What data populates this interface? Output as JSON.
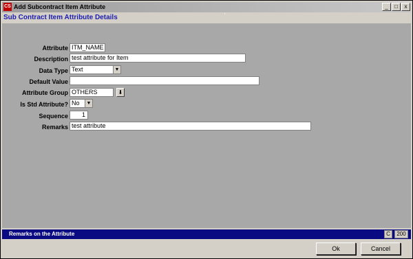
{
  "window": {
    "title": "Add Subcontract Item Attribute",
    "app_icon": "CS"
  },
  "title_buttons": {
    "minimize": "_",
    "maximize": "□",
    "close": "x"
  },
  "form": {
    "heading": "Sub Contract Item Attribute Details",
    "minor_mark": "'",
    "labels": {
      "attribute": "Attribute",
      "description": "Description",
      "data_type": "Data Type",
      "default_value": "Default Value",
      "attribute_group": "Attribute Group",
      "is_std_attribute": "Is Std Attribute?",
      "sequence": "Sequence",
      "remarks": "Remarks"
    },
    "values": {
      "attribute": "ITM_NAME",
      "description": "test attribute for Item",
      "data_type": "Text",
      "default_value": "",
      "attribute_group": "OTHERS",
      "is_std_attribute": "No",
      "sequence": "1",
      "remarks": "test attribute"
    }
  },
  "status": {
    "message": "Remarks on the Attribute",
    "mode": "C",
    "max_length": "200"
  },
  "buttons": {
    "ok": "Ok",
    "cancel": "Cancel"
  },
  "icons": {
    "dropdown": "▼",
    "lookup": "⬇"
  }
}
